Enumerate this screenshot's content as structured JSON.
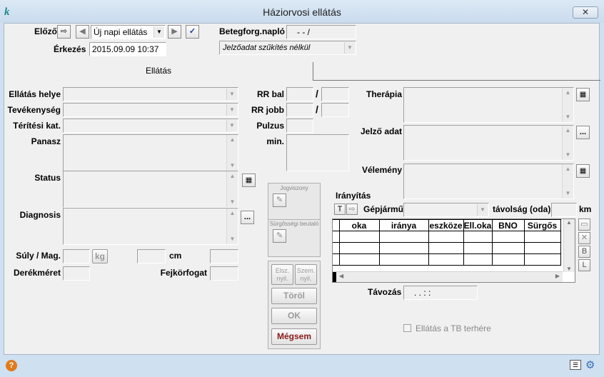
{
  "window": {
    "title": "Háziorvosi ellátás",
    "close_glyph": "✕",
    "app_icon_glyph": "k"
  },
  "top": {
    "prev_label": "Előző",
    "dropdown_value": "Új napi ellátás",
    "beteg_label": "Betegforg.napló",
    "beteg_value": "- - /",
    "arrival_label": "Érkezés",
    "arrival_value": "2015.09.09 10:37",
    "jelzo_filter": "Jelzőadat szűkítés nélkül"
  },
  "tabs": {
    "active": "Ellátás"
  },
  "left_fields": {
    "ellatas_helye": "Ellátás helye",
    "tevekenyseg": "Tevékenység",
    "teritesi": "Térítési kat.",
    "panasz": "Panasz",
    "status": "Status",
    "diagnosis": "Diagnosis",
    "suly": "Súly / Mag.",
    "kg": "kg",
    "cm": "cm",
    "derekmeret": "Derékméret",
    "fejkorfogat": "Fejkörfogat"
  },
  "middle_fields": {
    "rr_bal": "RR bal",
    "rr_jobb": "RR jobb",
    "pulzus": "Pulzus",
    "min": "min.",
    "slash": "/",
    "jogviszony": "Jogviszony",
    "surgossegi": "Sürgősségi beutaló",
    "elsz": "Elsz. nyil.",
    "szem": "Szem. nyil.",
    "torol": "Töröl",
    "ok": "OK",
    "megsem": "Mégsem"
  },
  "right_fields": {
    "therapia": "Therápia",
    "jelzo_adat": "Jelző adat",
    "velemeny": "Vélemény",
    "iranyitas": "Irányítás",
    "gepjarmu": "Gépjármű",
    "tavolsag": "távolság (oda)",
    "km": "km",
    "t_btn": "T",
    "tavozas": "Távozás",
    "tavozas_value": ". . : :",
    "ellatas_tb": "Ellátás a TB terhére",
    "ellipsis": "...",
    "side_b": "B",
    "side_l": "L"
  },
  "grid": {
    "columns": [
      "oka",
      "iránya",
      "eszköze",
      "Ell.oka",
      "BNO",
      "Sürgős"
    ]
  },
  "colors": {
    "ok_text": "#000000",
    "megsem_text": "#8b1a1a",
    "check_blue": "#1a3c9c"
  }
}
